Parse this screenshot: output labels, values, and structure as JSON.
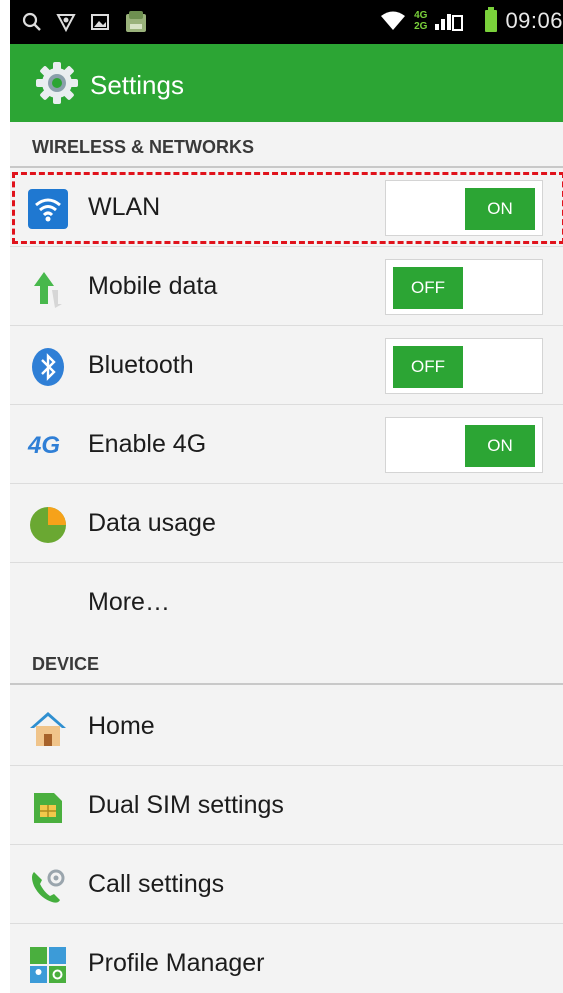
{
  "status_bar": {
    "net_top": "4G",
    "net_bottom": "2G",
    "time": "09:06",
    "icons": [
      "search-icon",
      "location-icon",
      "gallery-icon",
      "app-store-icon",
      "wifi-icon",
      "signal-icon",
      "battery-icon"
    ]
  },
  "action_bar": {
    "title": "Settings",
    "icon": "gear-icon",
    "color": "#2ca534"
  },
  "sections": {
    "wireless": "WIRELESS & NETWORKS",
    "device": "DEVICE"
  },
  "rows": {
    "wlan": {
      "label": "WLAN",
      "toggle": "ON",
      "icon": "wifi-icon"
    },
    "mobile_data": {
      "label": "Mobile data",
      "toggle": "OFF",
      "icon": "mobile-data-arrow-icon"
    },
    "bluetooth": {
      "label": "Bluetooth",
      "toggle": "OFF",
      "icon": "bluetooth-icon"
    },
    "enable_4g": {
      "label": "Enable 4G",
      "toggle": "ON",
      "icon_text": "4G",
      "icon": "4g-icon"
    },
    "data_usage": {
      "label": "Data usage",
      "icon": "pie-chart-icon"
    },
    "more": {
      "label": "More…"
    },
    "home": {
      "label": "Home",
      "icon": "home-icon"
    },
    "dual_sim": {
      "label": "Dual SIM settings",
      "icon": "sim-card-icon"
    },
    "call_settings": {
      "label": "Call settings",
      "icon": "phone-gear-icon"
    },
    "profile_manager": {
      "label": "Profile Manager",
      "icon": "profile-manager-icon"
    }
  },
  "colors": {
    "accent": "#2ca534",
    "highlight": "#e0121b"
  }
}
